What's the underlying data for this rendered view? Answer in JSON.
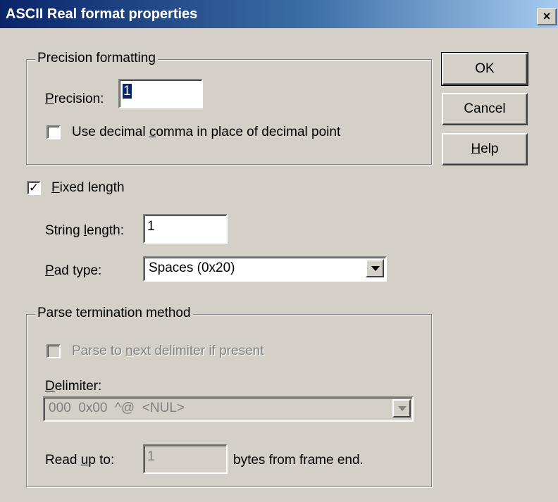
{
  "window": {
    "title": "ASCII Real format properties",
    "close_glyph": "×"
  },
  "precision_group": {
    "label": "Precision formatting",
    "precision_label_pre": "",
    "precision_label_key": "P",
    "precision_label_post": "recision:",
    "precision_value": "1",
    "decimal_comma": {
      "pre": "Use decimal ",
      "key": "c",
      "post": "omma in place of decimal point",
      "checked": false
    }
  },
  "buttons": {
    "ok": "OK",
    "cancel": "Cancel",
    "help_key": "H",
    "help_post": "elp"
  },
  "fixed_length": {
    "key": "F",
    "post": "ixed length",
    "checked": true,
    "check_glyph": "✓"
  },
  "string_length": {
    "pre": "String ",
    "key": "l",
    "post": "ength:",
    "value": "1"
  },
  "pad_type": {
    "key": "P",
    "post": "ad type:",
    "selected": "Spaces (0x20)"
  },
  "parse_group": {
    "label": "Parse termination method",
    "next_delim": {
      "pre": "Parse to ",
      "key": "n",
      "post": "ext delimiter if present",
      "checked": false
    },
    "delimiter_label_key": "D",
    "delimiter_label_post": "elimiter:",
    "delimiter_value": "000  0x00  ^@  <NUL>",
    "read_up_to_pre": "Read ",
    "read_up_to_key": "u",
    "read_up_to_post": "p to:",
    "read_up_to_value": "1",
    "bytes_suffix": "bytes from frame end."
  }
}
